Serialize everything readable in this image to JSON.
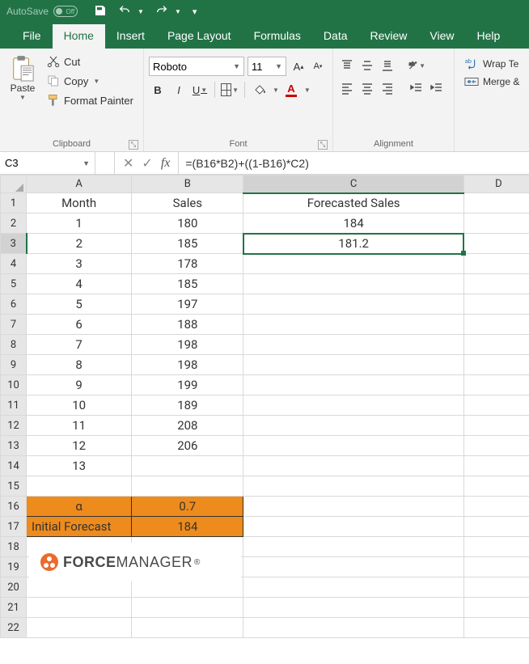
{
  "titlebar": {
    "autosave": "AutoSave",
    "toggle": "Off"
  },
  "tabs": [
    "File",
    "Home",
    "Insert",
    "Page Layout",
    "Formulas",
    "Data",
    "Review",
    "View",
    "Help"
  ],
  "active_tab": 1,
  "ribbon": {
    "clipboard": {
      "paste": "Paste",
      "cut": "Cut",
      "copy": "Copy",
      "format_painter": "Format Painter",
      "label": "Clipboard"
    },
    "font": {
      "name": "Roboto",
      "size": "11",
      "label": "Font",
      "bold": "B",
      "italic": "I",
      "underline": "U",
      "font_color_letter": "A"
    },
    "alignment": {
      "label": "Alignment",
      "wrap": "Wrap Te",
      "merge": "Merge &"
    }
  },
  "namebox": "C3",
  "formula": "=(B16*B2)+((1-B16)*C2)",
  "columns": [
    "A",
    "B",
    "C",
    "D"
  ],
  "grid": {
    "headers": {
      "A": "Month",
      "B": "Sales",
      "C": "Forecasted Sales"
    },
    "rows": [
      {
        "r": "1"
      },
      {
        "r": "2",
        "A": "1",
        "B": "180",
        "C": "184"
      },
      {
        "r": "3",
        "A": "2",
        "B": "185",
        "C": "181.2"
      },
      {
        "r": "4",
        "A": "3",
        "B": "178"
      },
      {
        "r": "5",
        "A": "4",
        "B": "185"
      },
      {
        "r": "6",
        "A": "5",
        "B": "197"
      },
      {
        "r": "7",
        "A": "6",
        "B": "188"
      },
      {
        "r": "8",
        "A": "7",
        "B": "198"
      },
      {
        "r": "9",
        "A": "8",
        "B": "198"
      },
      {
        "r": "10",
        "A": "9",
        "B": "199"
      },
      {
        "r": "11",
        "A": "10",
        "B": "189"
      },
      {
        "r": "12",
        "A": "11",
        "B": "208"
      },
      {
        "r": "13",
        "A": "12",
        "B": "206"
      },
      {
        "r": "14",
        "A": "13"
      },
      {
        "r": "15"
      },
      {
        "r": "16",
        "A": "α",
        "B": "0.7",
        "orange": true
      },
      {
        "r": "17",
        "A": "Initial Forecast",
        "B": "184",
        "orange": true,
        "left": true
      },
      {
        "r": "18"
      },
      {
        "r": "19"
      },
      {
        "r": "20"
      },
      {
        "r": "21"
      },
      {
        "r": "22"
      }
    ]
  },
  "logo": {
    "brand_bold": "FORCE",
    "brand_rest": "MANAGER",
    "reg": "®"
  },
  "selected": {
    "row": "3",
    "col": "C"
  }
}
